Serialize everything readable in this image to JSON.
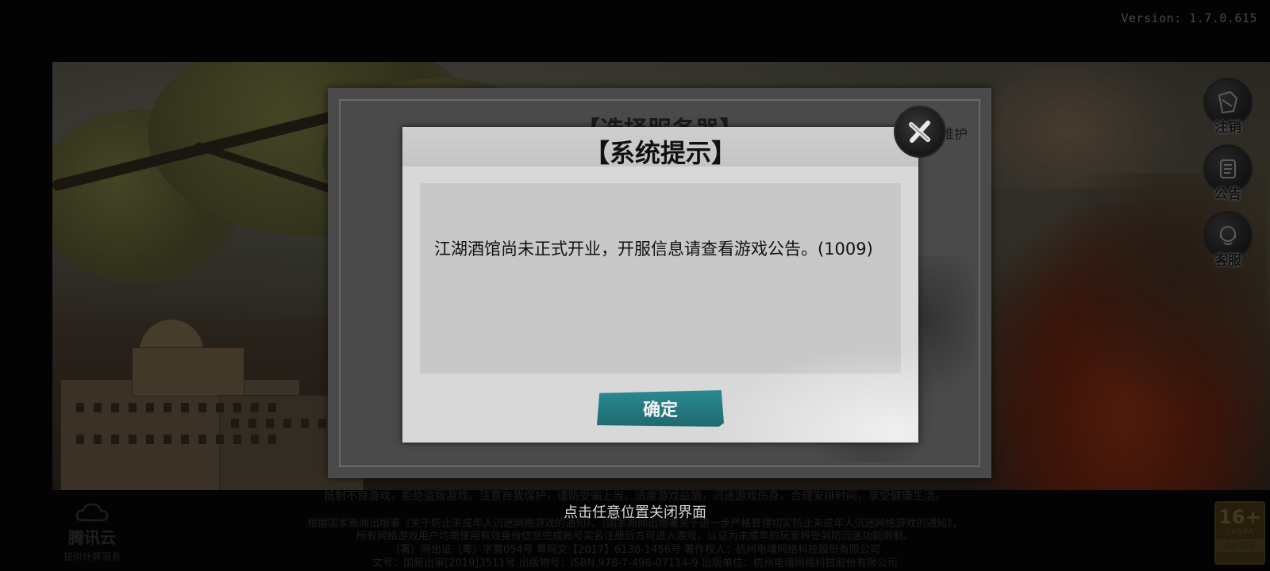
{
  "version_label": "Version: 1.7.0.615",
  "side_buttons": [
    {
      "label": "注销",
      "icon": "logout-icon"
    },
    {
      "label": "公告",
      "icon": "notice-scroll-icon"
    },
    {
      "label": "客服",
      "icon": "customer-service-icon"
    }
  ],
  "server_panel": {
    "title": "【选择服务器】",
    "side_text": "维护"
  },
  "dialog": {
    "title": "【系统提示】",
    "message": "江湖酒馆尚未正式开业，开服信息请查看游戏公告。(1009)",
    "confirm_label": "确定",
    "close_icon": "close-icon"
  },
  "close_hint": "点击任意位置关闭界面",
  "bottom_notice": {
    "line1": "抵制不良游戏，拒绝盗版游戏。注意自我保护，谨防受骗上当。适度游戏益脑，沉迷游戏伤身。合理安排时间，享受健康生活。",
    "line3": "根据国家新闻出版署《关于防止未成年人沉迷网络游戏的通知》、《国家新闻出版署关于进一步严格管理切实防止未成年人沉迷网络游戏的通知》，",
    "line4": "所有网络游戏用户均需使用有效身份信息完成账号实名注册后方可进入游戏，认证为未成年的玩家将受到防沉迷功能限制。",
    "line5": "（署）网出证（粤）字第054号  粤网文【2017】6138-1456号  著作权人：杭州电魂网络科技股份有限公司",
    "line6": "文号：国新出审[2019]3511号  出版物号：ISBN 978-7-498-07114-9  出版单位：杭州电魂网络科技股份有限公司"
  },
  "cloud_logo": {
    "name": "腾讯云",
    "sub": "提供计算服务"
  },
  "age_badge": {
    "age": "16+",
    "org": "CADPA",
    "tip": "适龄提示"
  }
}
